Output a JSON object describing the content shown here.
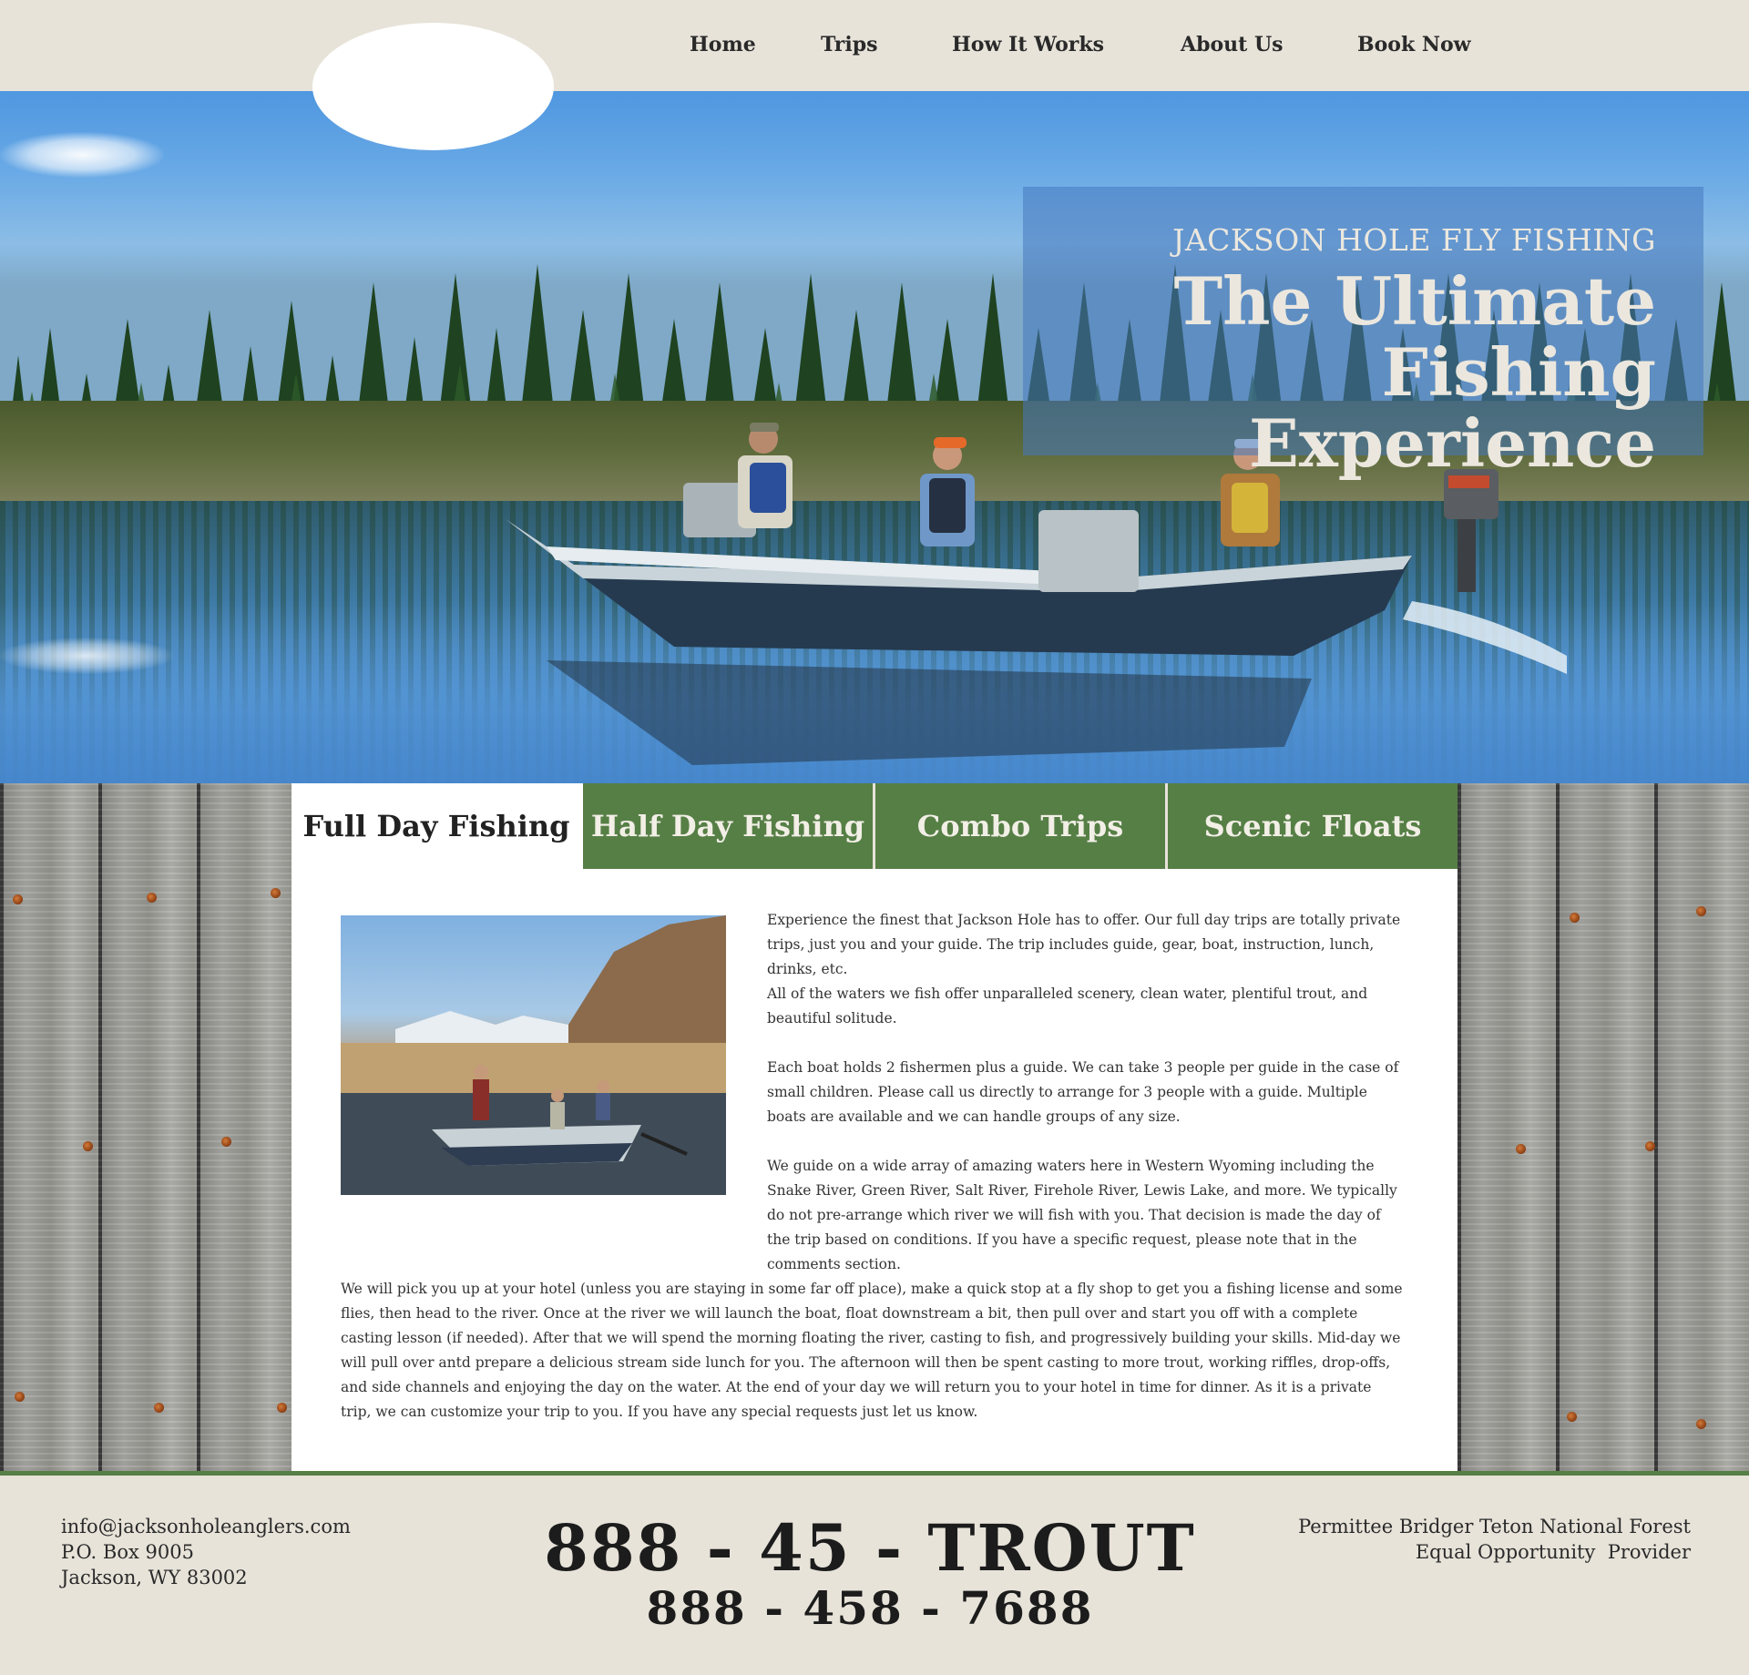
{
  "nav": {
    "items": [
      {
        "label": "Home"
      },
      {
        "label": "Trips"
      },
      {
        "label": "How It Works"
      },
      {
        "label": "About Us"
      },
      {
        "label": "Book Now"
      }
    ]
  },
  "hero": {
    "kicker": "JACKSON HOLE FLY FISHING",
    "title_line1": "The Ultimate",
    "title_line2": "Fishing Experience"
  },
  "tabs": [
    {
      "label": "Full Day Fishing",
      "active": true
    },
    {
      "label": "Half Day Fishing",
      "active": false
    },
    {
      "label": "Combo Trips",
      "active": false
    },
    {
      "label": "Scenic Floats",
      "active": false
    }
  ],
  "content": {
    "paragraphs_right": [
      "Experience the finest that Jackson Hole has to offer. Our full day trips are totally private trips, just you and your guide. The trip includes guide, gear, boat, instruction, lunch, drinks, etc.",
      "All of the waters we fish offer unparalleled scenery, clean water, plentiful trout, and beautiful solitude.",
      "Each boat holds 2 fishermen plus a guide. We can take 3 people per guide in the case of small children. Please call us directly to arrange for 3 people with a guide. Multiple boats are available and we can handle groups of any size.",
      "We guide on a wide array of amazing waters here in Western Wyoming including the Snake River, Green River, Salt River, Firehole River, Lewis Lake, and more. We typically do not pre-arrange which river we will fish with you. That decision is made the day of the trip based on conditions. If you have a specific request, please note that in the comments section."
    ],
    "paragraph_wide": "We will pick you up at your hotel (unless you are staying in some far off place), make a quick stop at a fly shop to get you a fishing license and some flies, then head to the river. Once at the river we will launch the boat, float downstream a bit, then pull over and start you off with a complete casting lesson (if needed). After that we will spend the morning floating the river, casting to fish, and progressively building your skills. Mid-day we will pull over antd prepare a delicious stream side lunch for you. The afternoon will then be spent casting to more trout, working riffles, drop-offs, and side channels and enjoying the day on the water. At the end of your day we will return you to your hotel in time for dinner. As it is a private trip, we can customize your trip to you. If you have any special requests just let us know."
  },
  "footer": {
    "email": "info@jacksonholeanglers.com",
    "po_box": "P.O. Box 9005",
    "city": "Jackson, WY 83002",
    "phone_vanity": "888 - 45 - TROUT",
    "phone_number": "888 - 458 - 7688",
    "permittee": "Permittee Bridger Teton National Forest",
    "equal_opportunity": "Equal Opportunity  Provider"
  },
  "colors": {
    "header_bg": "#e7e3d9",
    "tab_green": "#567f46",
    "hero_panel": "#4678be",
    "footer_bg": "#e7e3d9"
  }
}
